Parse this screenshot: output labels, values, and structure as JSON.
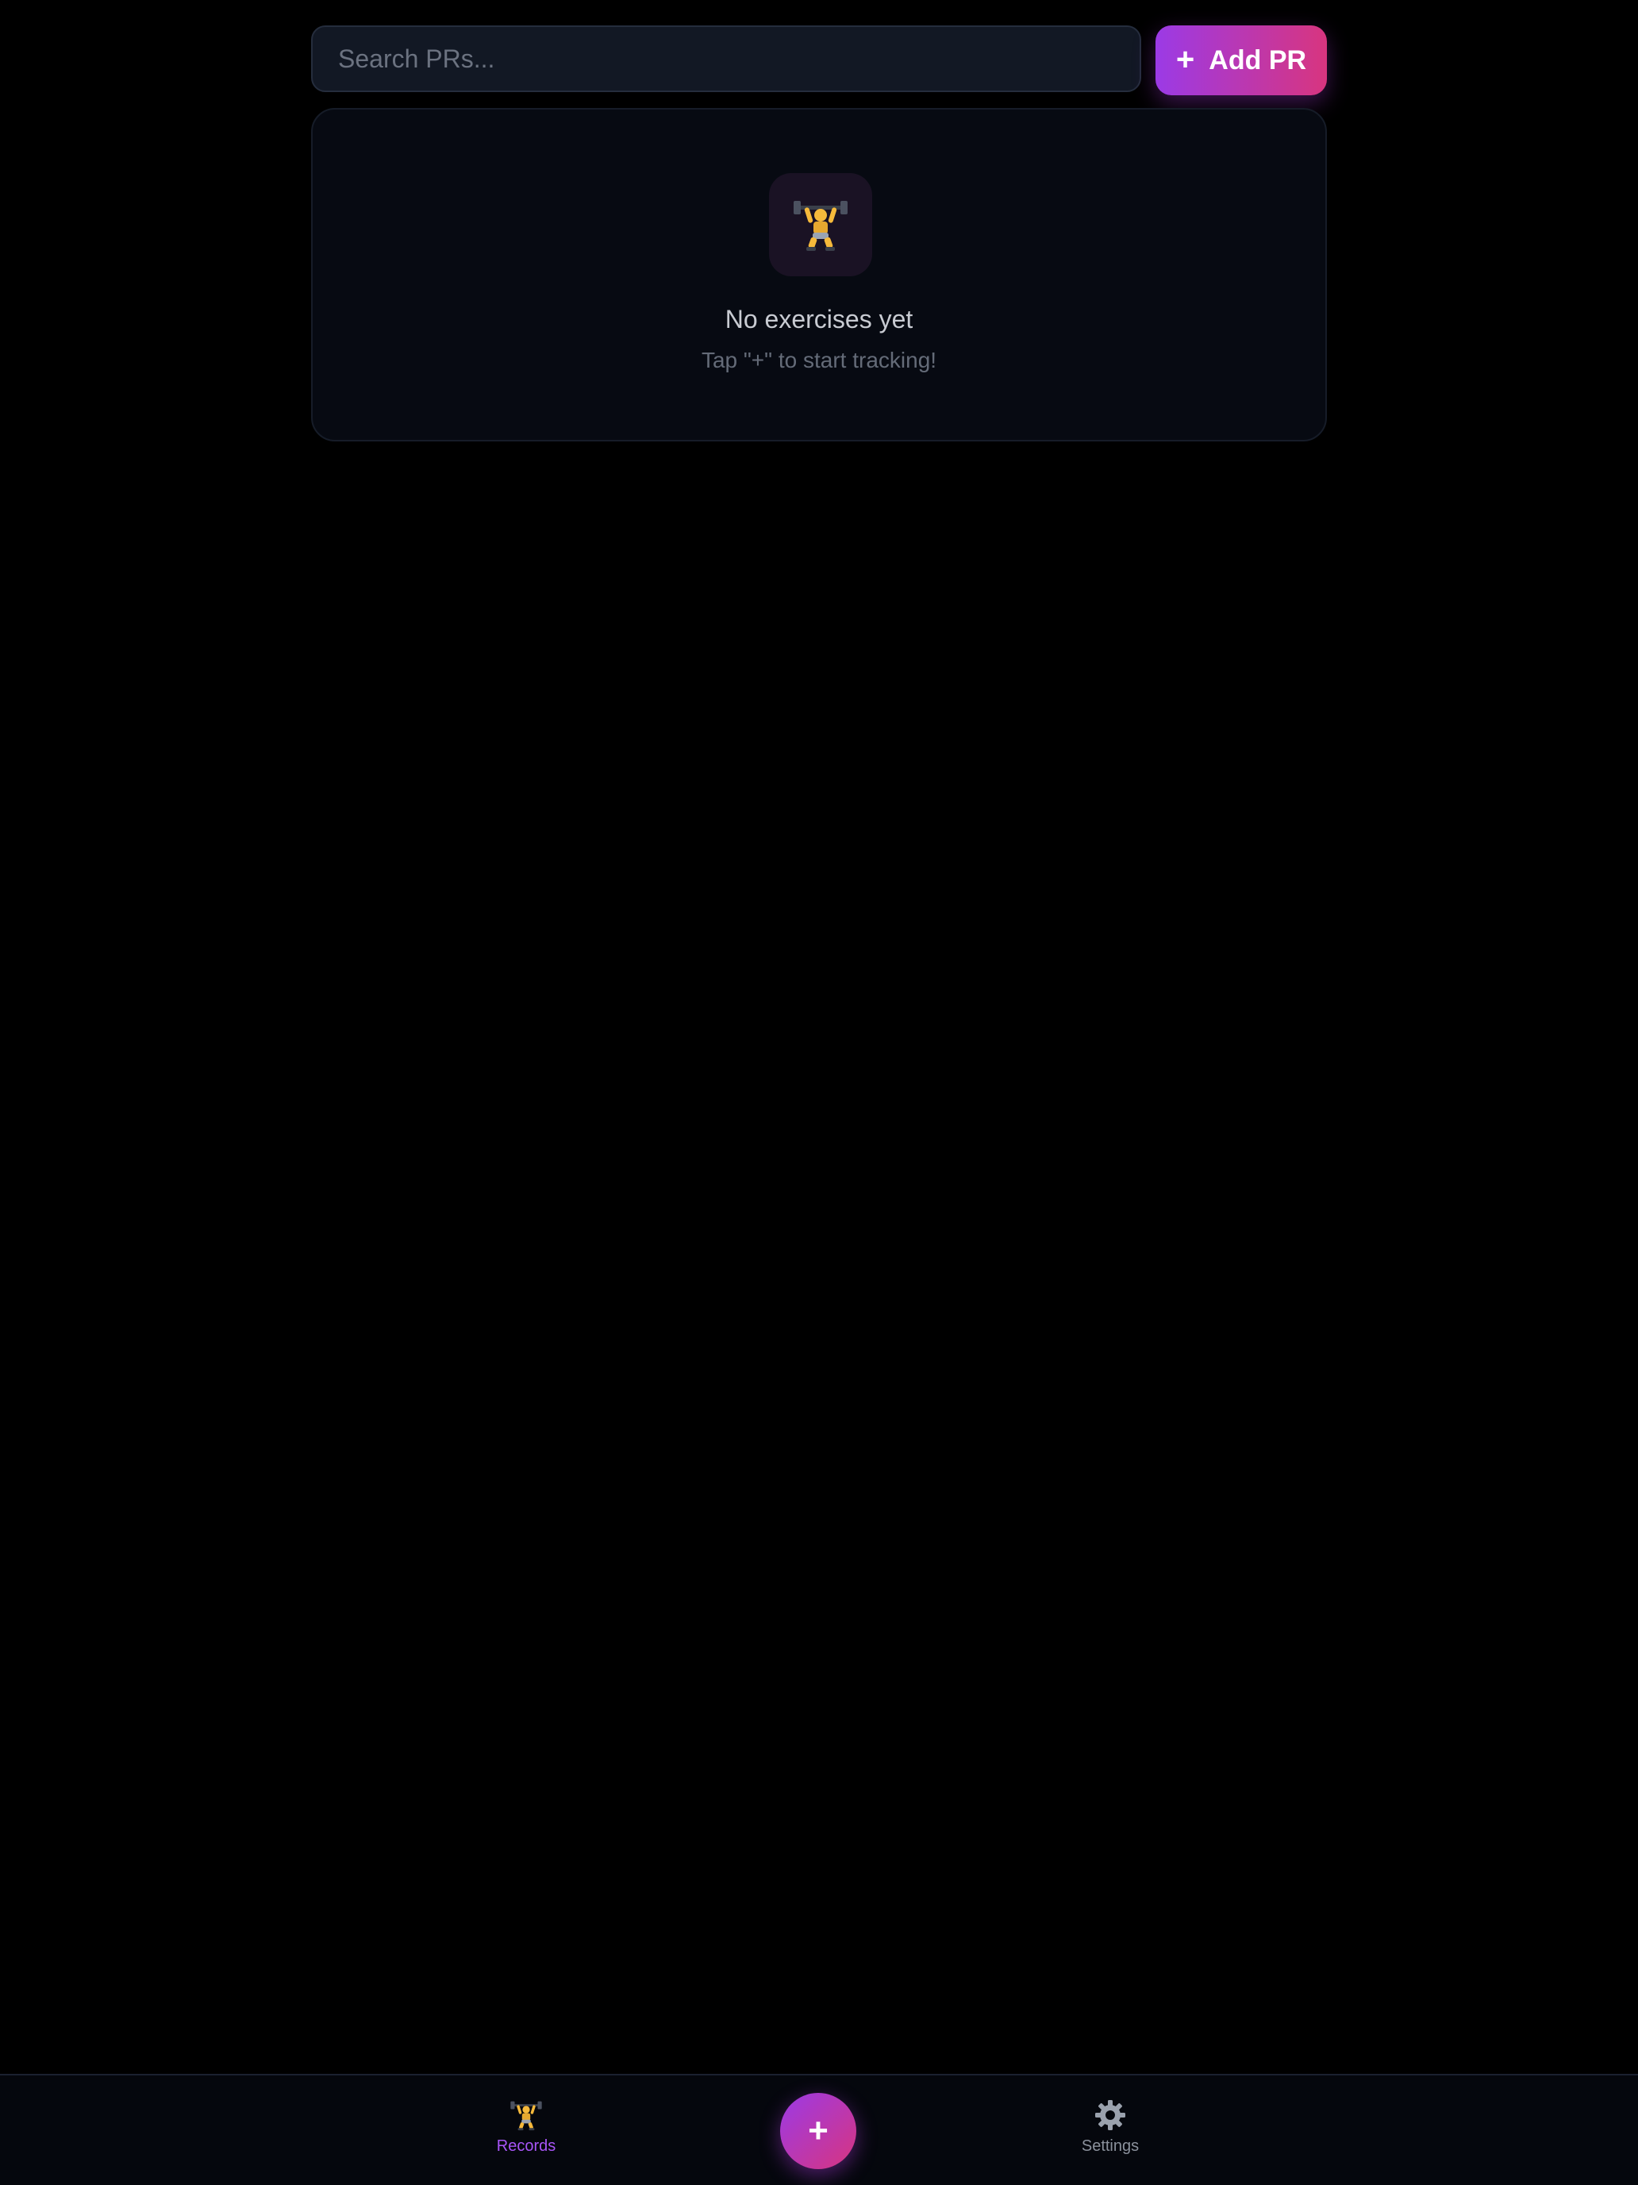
{
  "search": {
    "placeholder": "Search PRs..."
  },
  "header": {
    "add_pr_plus": "+",
    "add_pr_label": "Add PR"
  },
  "empty_state": {
    "icon": "weightlifter-icon",
    "title": "No exercises yet",
    "subtitle": "Tap \"+\" to start tracking!"
  },
  "bottom_nav": {
    "items": [
      {
        "label": "Records",
        "icon": "weightlifter-icon",
        "active": true
      },
      {
        "label": "Settings",
        "icon": "gear-icon",
        "active": false
      }
    ],
    "fab_label": "+"
  },
  "colors": {
    "accent_start": "#9b3ae6",
    "accent_end": "#d8357f",
    "active_nav": "#a855f7",
    "background": "#000000"
  }
}
